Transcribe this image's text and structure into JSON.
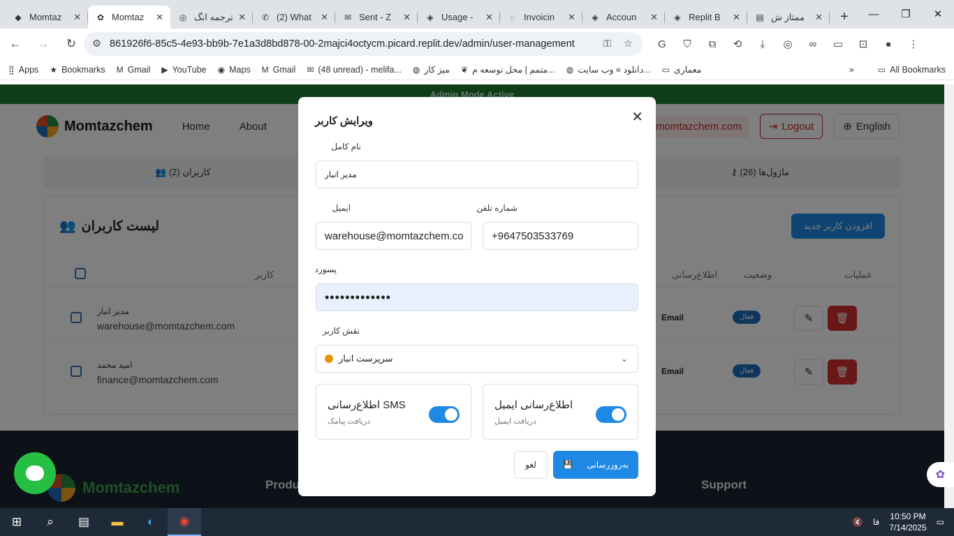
{
  "browser": {
    "tabs": [
      {
        "label": "Momtaz",
        "icon": "orange-brand-icon",
        "active": false
      },
      {
        "label": "Momtaz",
        "icon": "momtazchem-icon",
        "active": true
      },
      {
        "label": "ترجمه انگ",
        "icon": "openai-icon",
        "active": false
      },
      {
        "label": "(2) What",
        "icon": "whatsapp-icon",
        "active": false
      },
      {
        "label": "Sent - Z",
        "icon": "mail-icon",
        "active": false
      },
      {
        "label": "Usage -",
        "icon": "replit-icon",
        "active": false
      },
      {
        "label": "Invoicin",
        "icon": "loading-icon",
        "active": false
      },
      {
        "label": "Accoun",
        "icon": "replit-icon",
        "active": false
      },
      {
        "label": "Replit B",
        "icon": "replit-icon",
        "active": false
      },
      {
        "label": "ممتاز ش",
        "icon": "docs-icon",
        "active": false
      }
    ],
    "url": "861926f6-85c5-4e93-bb9b-7e1a3d8bd878-00-2majci4octycm.picard.replit.dev/admin/user-management",
    "bookmarks": [
      {
        "label": "Apps",
        "icon": "apps-grid-icon"
      },
      {
        "label": "Bookmarks",
        "icon": "star-icon"
      },
      {
        "label": "Gmail",
        "icon": "gmail-icon"
      },
      {
        "label": "YouTube",
        "icon": "youtube-icon"
      },
      {
        "label": "Maps",
        "icon": "maps-icon"
      },
      {
        "label": "Gmail",
        "icon": "gmail-icon"
      },
      {
        "label": "(48 unread) - melifa...",
        "icon": "yahoo-icon"
      },
      {
        "label": "میز کار",
        "icon": "globe-icon"
      },
      {
        "label": "متمم | محل توسعه م...",
        "icon": "leaf-icon"
      },
      {
        "label": "دانلود » وب سایت...",
        "icon": "globe-icon"
      },
      {
        "label": "معماری",
        "icon": "folder-icon"
      }
    ],
    "all_bookmarks": "All Bookmarks"
  },
  "site": {
    "banner": "Admin Mode Active",
    "brand": "Momtazchem",
    "nav": [
      "Home",
      "About"
    ],
    "user_email": "@momtazchem.com",
    "logout": "Logout",
    "language": "English",
    "tab_users": "کاربران (2)",
    "tab_modules": "ماژول‌ها (26)",
    "list_title": "لیست کاربران",
    "add_user": "افزودن کاربر جدید",
    "columns": {
      "user": "کاربر",
      "notify": "اطلاع‌رسانی",
      "status": "وضعیت",
      "actions": "عملیات"
    },
    "rows": [
      {
        "name": "مدیر انبار",
        "email": "warehouse@momtazchem.com",
        "notify": "Email",
        "status": "فعال"
      },
      {
        "name": "امید محمد",
        "email": "finance@momtazchem.com",
        "notify": "Email",
        "status": "فعال"
      }
    ],
    "footer": {
      "brand": "Momtazchem",
      "products": "Produ",
      "support": "Support"
    }
  },
  "modal": {
    "title": "ویرایش کاربر",
    "fullname_label": "نام کامل",
    "fullname_value": "مدیر انبار",
    "email_label": "ایمیل",
    "email_value": "warehouse@momtazchem.co",
    "phone_label": "شماره تلفن",
    "phone_value": "+9647503533769",
    "password_label": "پسورد",
    "password_value": "•••••••••••••",
    "role_label": "نقش کاربر",
    "role_value": "سرپرست انبار",
    "role_color": "#e69500",
    "sms_title": "اطلاع‌رسانی SMS",
    "sms_sub": "دریافت پیامک",
    "sms_enabled": true,
    "email_title": "اطلاع‌رسانی ایمیل",
    "email_sub": "دریافت ایمیل",
    "email_enabled": true,
    "cancel": "لغو",
    "save": "به‌روزرسانی"
  },
  "taskbar": {
    "time": "10:50 PM",
    "date": "7/14/2025",
    "lang": "فا"
  }
}
